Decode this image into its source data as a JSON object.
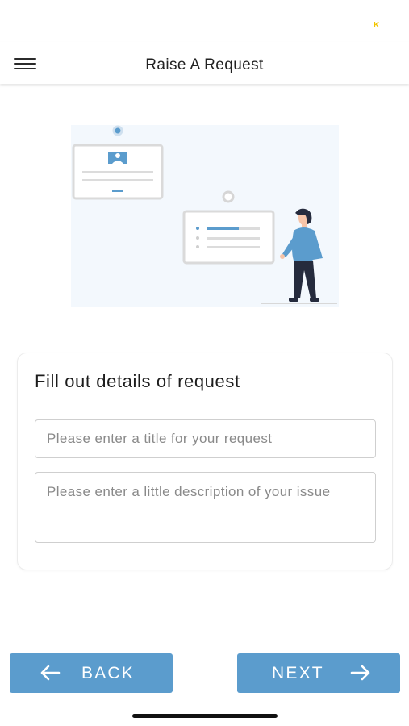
{
  "status_bar": {
    "indicator": "K"
  },
  "header": {
    "menu_icon": "hamburger-menu-icon",
    "title": "Raise A Request"
  },
  "illustration": {
    "icon": "person-with-form-cards-illustration",
    "colors": {
      "background": "#f3f8fd",
      "card_border": "#dcdcdc",
      "accent": "#5b9ccd",
      "person_shirt": "#5b9ccd",
      "person_pants": "#252b3d"
    }
  },
  "form": {
    "heading": "Fill out details of request",
    "title_placeholder": "Please enter a title for your request",
    "title_value": "",
    "description_placeholder": "Please enter a little description of your issue",
    "description_value": ""
  },
  "footer": {
    "back_label": "BACK",
    "back_icon": "arrow-left-icon",
    "next_label": "NEXT",
    "next_icon": "arrow-right-icon",
    "button_color": "#5b9ccd"
  }
}
